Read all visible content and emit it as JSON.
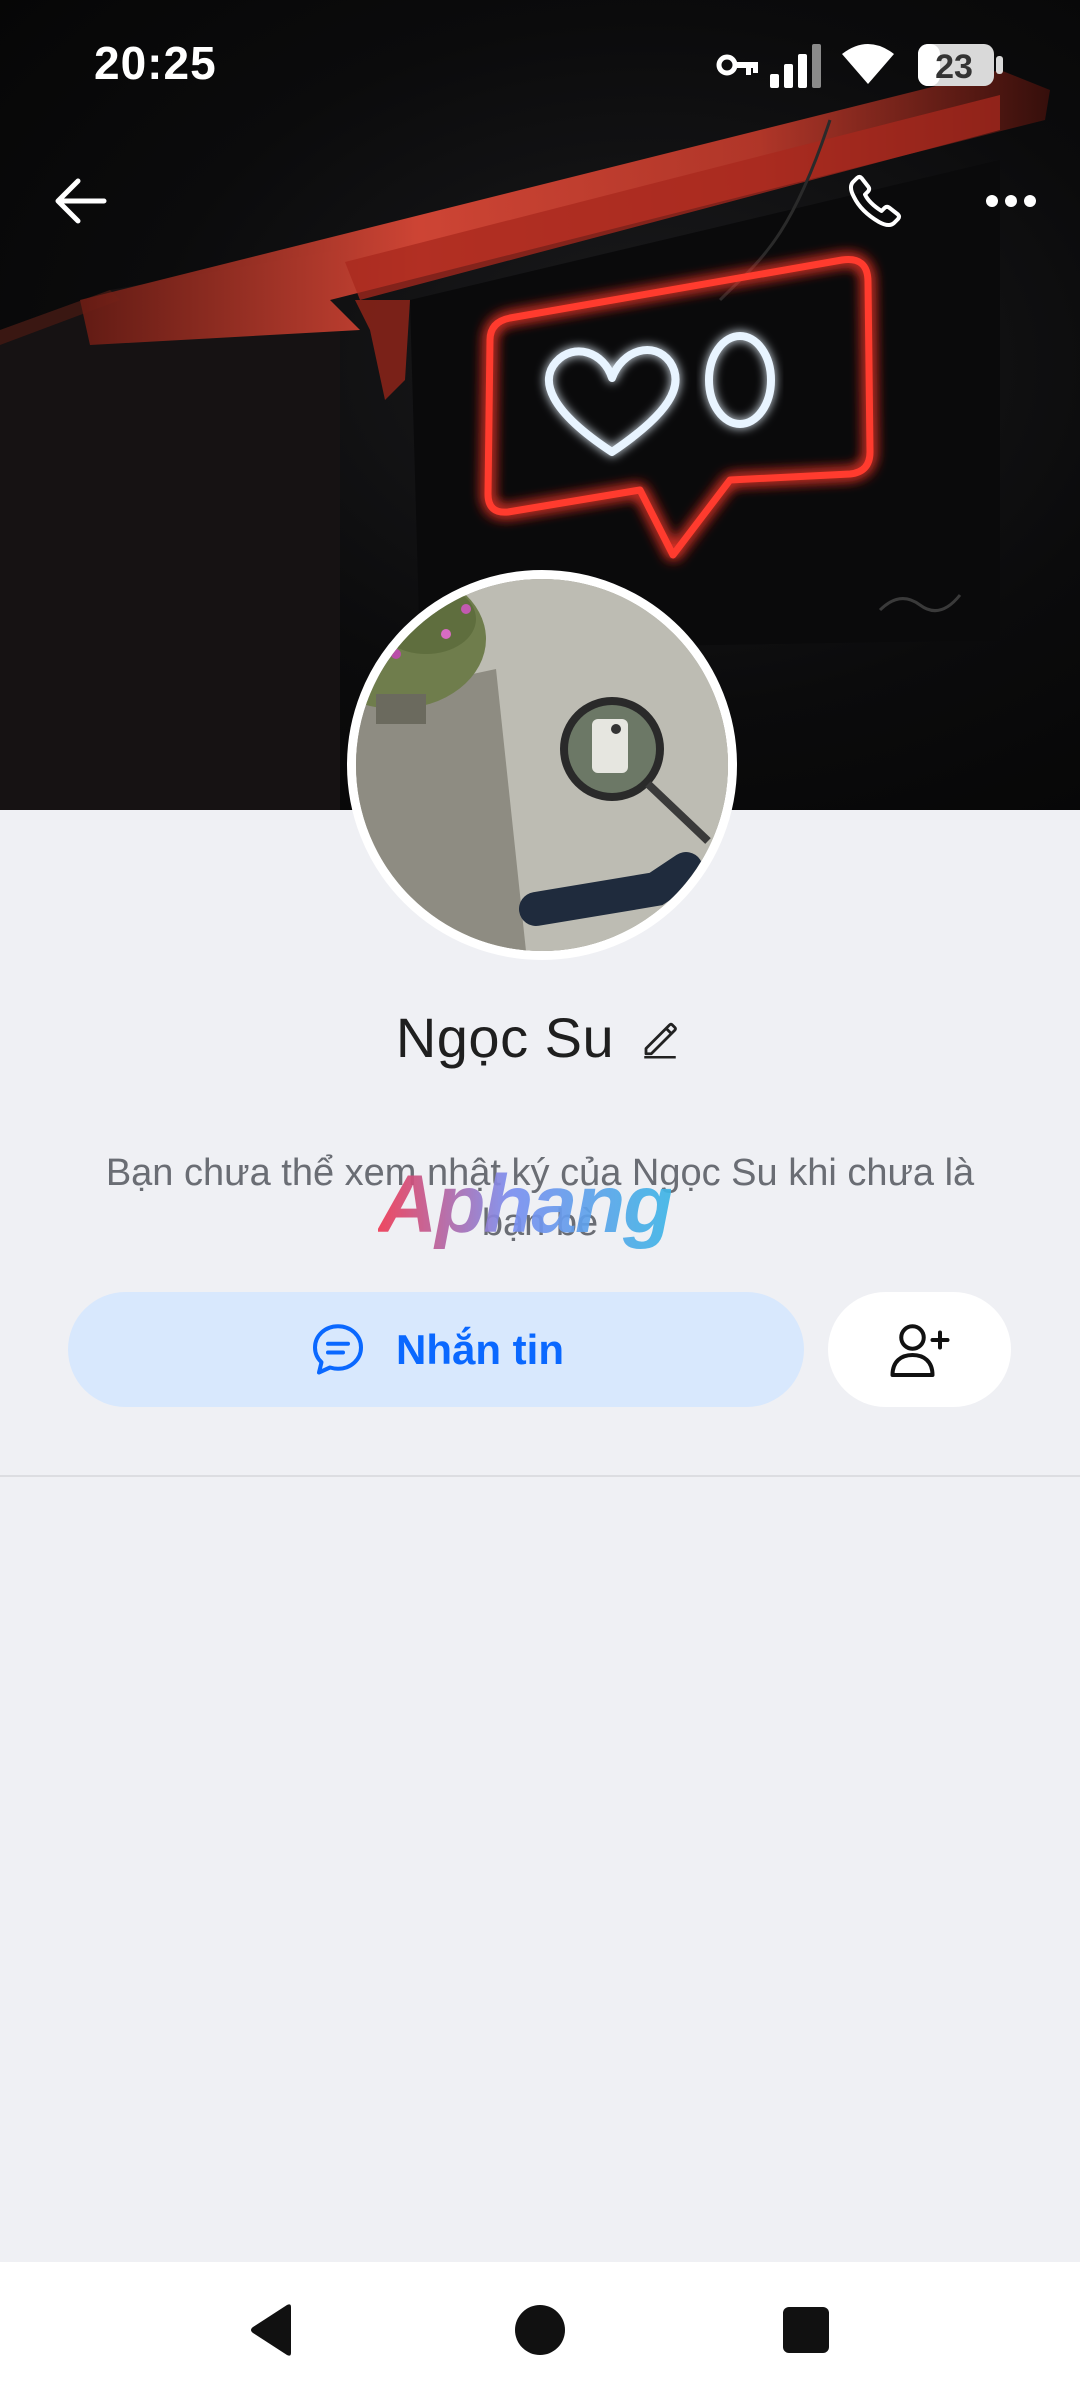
{
  "status_bar": {
    "time": "20:25",
    "battery_level": "23",
    "icons": [
      "key-icon",
      "signal-icon",
      "wifi-icon",
      "battery-icon"
    ]
  },
  "top_nav": {
    "icons": [
      "back-arrow-icon",
      "phone-icon",
      "more-dots-icon"
    ]
  },
  "profile": {
    "name": "Ngọc Su",
    "description": "Bạn chưa thể xem nhật ký của Ngọc Su khi chưa là bạn bè",
    "watermark": "Aphang"
  },
  "actions": {
    "message_label": "Nhắn tin",
    "message_icon": "chat-bubble-icon",
    "add_friend_icon": "add-friend-icon"
  },
  "system_nav": {
    "icons": [
      "back-triangle-icon",
      "home-circle-icon",
      "recents-square-icon"
    ]
  },
  "colors": {
    "accent": "#0a68ff",
    "message_button_bg": "#d8e8fd",
    "page_bg": "#eff0f4",
    "neon_red": "#ff3b2f",
    "neon_white": "#e8f4ff"
  }
}
